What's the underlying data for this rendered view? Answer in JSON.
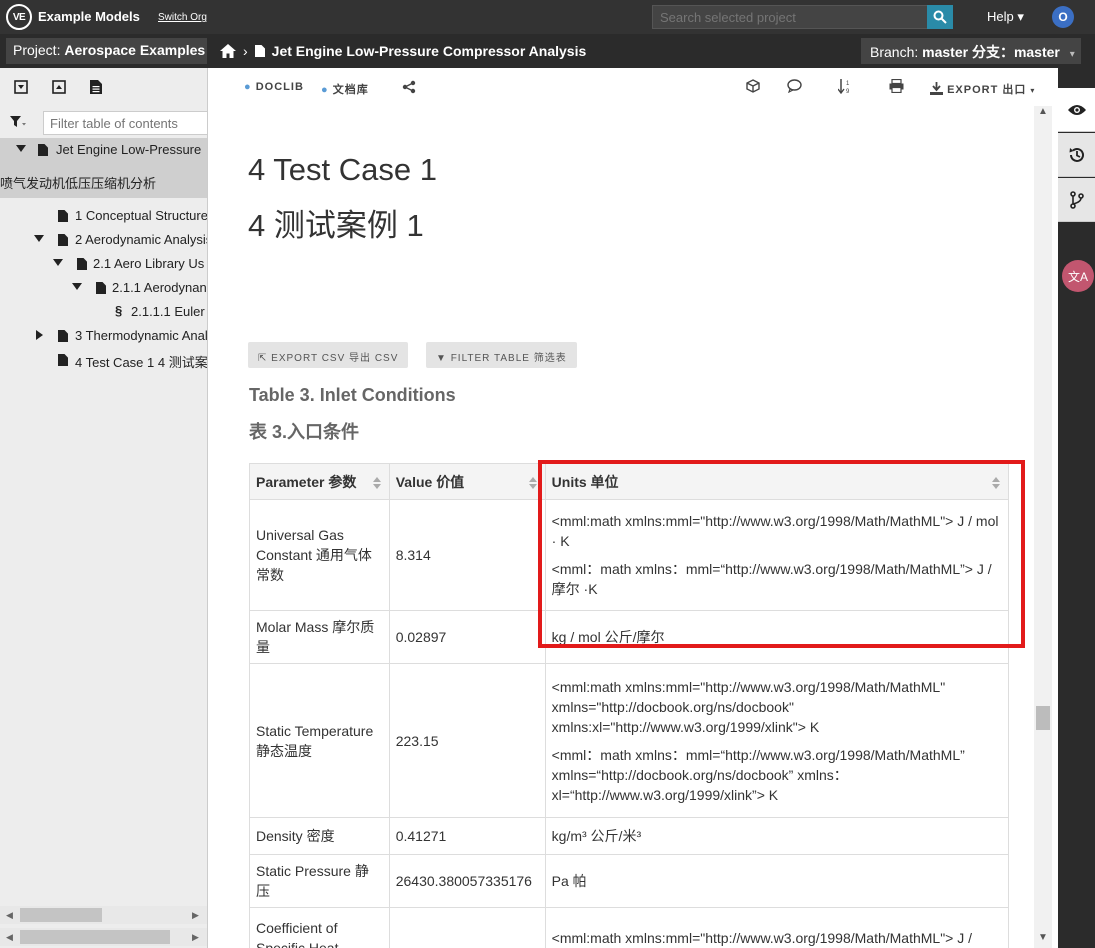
{
  "topbar": {
    "logo_text": "VE",
    "app_title": "Example Models",
    "switch_org": "Switch Org",
    "search_placeholder": "Search selected project",
    "help": "Help ▾",
    "avatar": "O"
  },
  "projectbar": {
    "project_label": "Project:",
    "project_name": "Aerospace Examples",
    "breadcrumb_sep": "›",
    "breadcrumb_page": "Jet Engine Low-Pressure Compressor Analysis",
    "branch_label": "Branch:",
    "branch_value": "master 分支：master",
    "branch_caret": "▾"
  },
  "left": {
    "filter_placeholder": "Filter table of contents",
    "tree": [
      {
        "label": "Jet Engine Low-Pressure",
        "label2": "喷气发动机低压压缩机分析"
      },
      {
        "label": "1 Conceptual Structure"
      },
      {
        "label": "2 Aerodynamic Analysis"
      },
      {
        "label": "2.1 Aero Library Us"
      },
      {
        "label": "2.1.1 Aerodynan"
      },
      {
        "label": "2.1.1.1 Euler"
      },
      {
        "label": "3 Thermodynamic Anal"
      },
      {
        "label": "4 Test Case 1 4 测试案"
      }
    ]
  },
  "doctools": {
    "doclib": "DOCLIB",
    "doclib_cn": "文档库",
    "export": "EXPORT 出口"
  },
  "content": {
    "heading_en": "4 Test Case 1",
    "heading_cn": "4 测试案例 1",
    "export_csv": "EXPORT CSV 导出 CSV",
    "filter_table": "FILTER TABLE 筛选表",
    "caption_en": "Table 3. Inlet Conditions",
    "caption_cn": "表 3.入口条件",
    "table": {
      "headers": [
        "Parameter 参数",
        "Value 价值",
        "Units 单位"
      ],
      "rows": [
        {
          "param": "Universal Gas Constant 通用气体常数",
          "value": "8.314",
          "units": [
            "<mml:math xmlns:mml=\"http://www.w3.org/1998/Math/MathML\"> J / mol · K",
            "<mml：math xmlns：mml=“http://www.w3.org/1998/Math/MathML”> J / 摩尔 ·K"
          ]
        },
        {
          "param": "Molar Mass 摩尔质量",
          "value": "0.02897",
          "units": [
            "kg / mol 公斤/摩尔"
          ]
        },
        {
          "param": "Static Temperature 静态温度",
          "value": "223.15",
          "units": [
            "<mml:math xmlns:mml=\"http://www.w3.org/1998/Math/MathML\" xmlns=\"http://docbook.org/ns/docbook\" xmlns:xl=\"http://www.w3.org/1999/xlink\"> K",
            "<mml：math xmlns：mml=“http://www.w3.org/1998/Math/MathML” xmlns=“http://docbook.org/ns/docbook” xmlns：xl=“http://www.w3.org/1999/xlink”> K"
          ]
        },
        {
          "param": "Density 密度",
          "value": "0.41271",
          "units": [
            "kg/m³ 公斤/米³"
          ]
        },
        {
          "param": "Static Pressure 静压",
          "value": "26430.380057335176",
          "units": [
            "Pa 帕"
          ]
        },
        {
          "param": "Coefficient of Specific Heat",
          "value": "",
          "units": [
            "<mml:math xmlns:mml=\"http://www.w3.org/1998/Math/MathML\"> J /"
          ]
        }
      ]
    }
  },
  "colors": {
    "topbar": "#333333",
    "highlight": "#e21a1a",
    "search_button": "#2a8ba8",
    "avatar": "#3b6fc4"
  }
}
